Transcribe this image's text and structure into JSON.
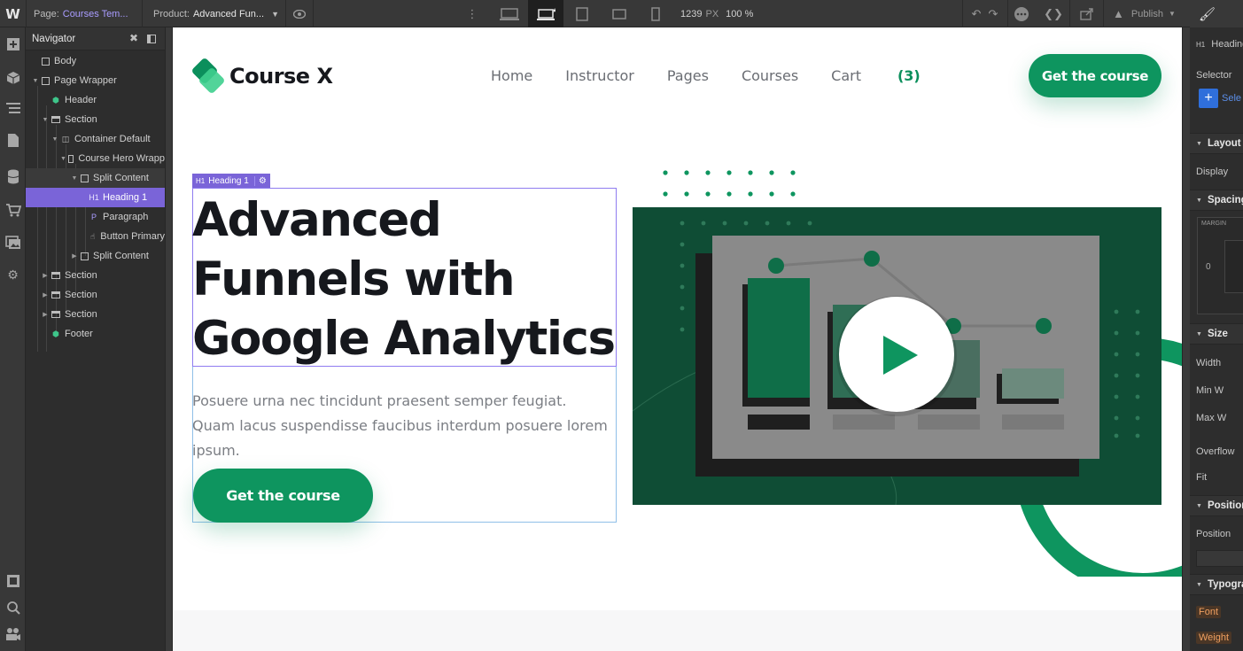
{
  "topbar": {
    "page_label": "Page:",
    "page_value": "Courses Tem...",
    "product_label": "Product:",
    "product_value": "Advanced Fun...",
    "width_value": "1239",
    "width_unit": "PX",
    "zoom": "100 %",
    "publish_label": "Publish"
  },
  "navigator": {
    "title": "Navigator",
    "items": [
      {
        "label": "Body"
      },
      {
        "label": "Page Wrapper"
      },
      {
        "label": "Header"
      },
      {
        "label": "Section"
      },
      {
        "label": "Container Default"
      },
      {
        "label": "Course Hero Wrapp"
      },
      {
        "label": "Split Content"
      },
      {
        "label": "Heading 1",
        "icon": "H1"
      },
      {
        "label": "Paragraph",
        "icon": "P"
      },
      {
        "label": "Button Primary"
      },
      {
        "label": "Split Content"
      },
      {
        "label": "Section"
      },
      {
        "label": "Section"
      },
      {
        "label": "Section"
      },
      {
        "label": "Footer"
      }
    ]
  },
  "site": {
    "logo_text": "Course X",
    "nav": [
      {
        "label": "Home"
      },
      {
        "label": "Instructor"
      },
      {
        "label": "Pages"
      },
      {
        "label": "Courses"
      }
    ],
    "cart_label": "Cart",
    "cart_count": "(3)",
    "header_cta": "Get the course",
    "hero_title_lines": [
      "Advanced",
      "Funnels with",
      "Google Analytics"
    ],
    "hero_paragraph": "Posuere urna nec tincidunt praesent semper feugiat. Quam lacus suspendisse faucibus interdum posuere lorem ipsum.",
    "hero_cta": "Get the course",
    "selection_tag": "Heading 1",
    "selection_tag_prefix": "H1"
  },
  "right_panel": {
    "element_label": "Heading",
    "element_prefix": "H1",
    "selector_label": "Selector",
    "selector_value": "Sele",
    "sections": {
      "layout": "Layout",
      "spacing": "Spacing",
      "size": "Size",
      "position": "Position",
      "typography": "Typography"
    },
    "labels": {
      "display": "Display",
      "margin": "MARGIN",
      "margin_value": "0",
      "width": "Width",
      "min_w": "Min W",
      "max_w": "Max W",
      "overflow": "Overflow",
      "fit": "Fit",
      "position": "Position",
      "font": "Font",
      "weight": "Weight"
    }
  },
  "colors": {
    "brand_green": "#0e955f",
    "brand_green_light": "#3ecf8e",
    "selection_purple": "#7a64d8",
    "dark_green_panel": "#0f4d35"
  }
}
